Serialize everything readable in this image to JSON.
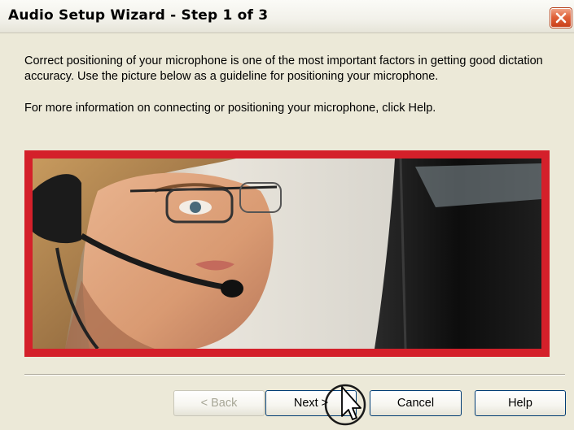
{
  "window": {
    "title": "Audio Setup Wizard - Step 1 of 3"
  },
  "content": {
    "paragraph1": "Correct positioning of your microphone is one of the most important factors in getting good dictation accuracy.  Use the picture below as a guideline for positioning your microphone.",
    "paragraph2": "For more information on connecting or positioning your microphone, click Help."
  },
  "image": {
    "description_icon": "headset-user-photo",
    "frame_color": "#d4202a"
  },
  "buttons": {
    "back": "< Back",
    "next": "Next >",
    "cancel": "Cancel",
    "help": "Help"
  },
  "colors": {
    "close_button": "#e0623a",
    "dialog_bg": "#ece9d8"
  }
}
